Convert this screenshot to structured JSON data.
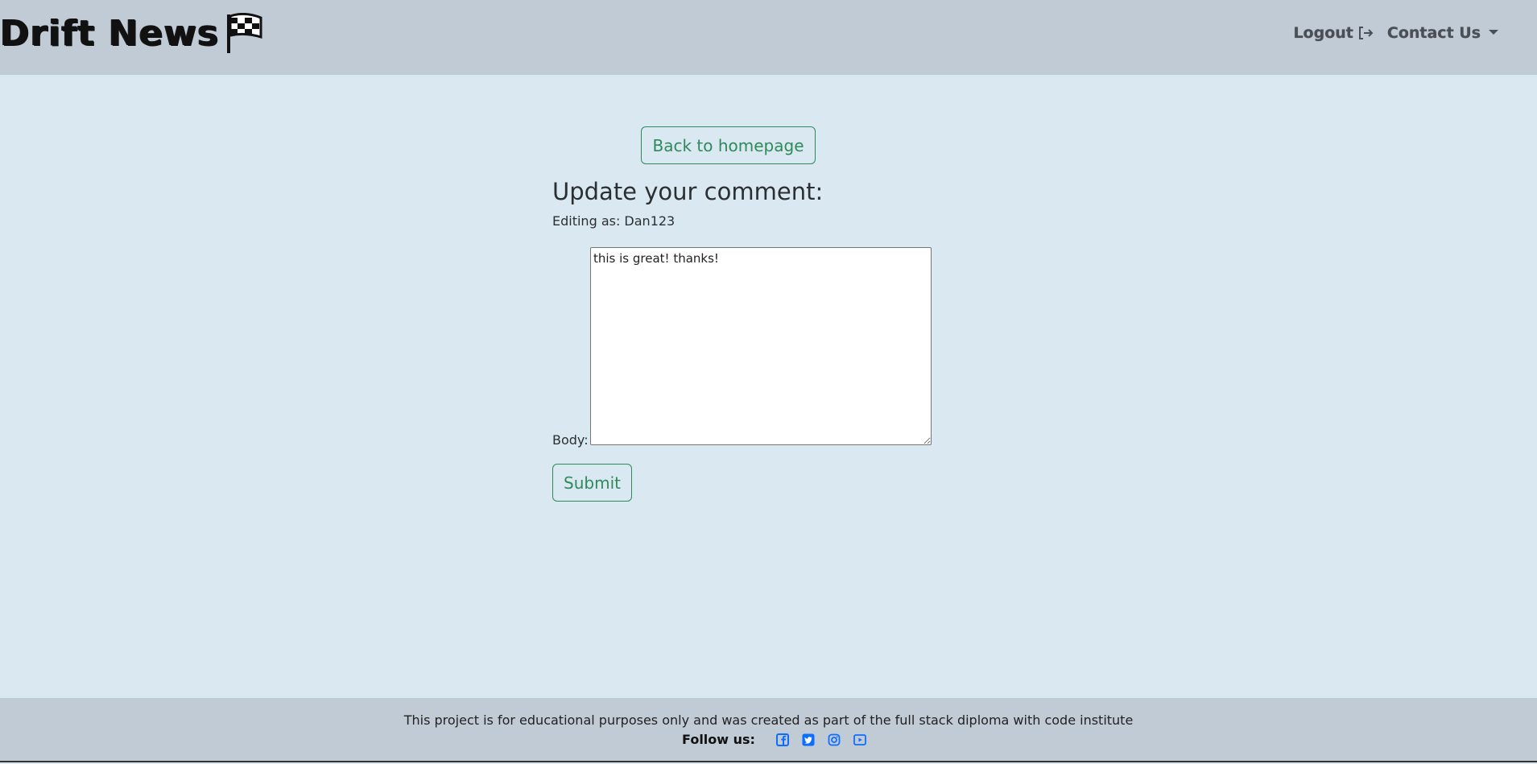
{
  "navbar": {
    "brand": "Drift News",
    "logout_label": "Logout",
    "contact_label": "Contact Us"
  },
  "main": {
    "back_label": "Back to homepage",
    "heading": "Update your comment:",
    "editing_as": "Editing as: Dan123",
    "body_label": "Body:",
    "body_value": "this is great! thanks!",
    "submit_label": "Submit"
  },
  "footer": {
    "text": "This project is for educational purposes only and was created as part of the full stack diploma with code institute",
    "follow_label": "Follow us:",
    "social_icons": [
      "facebook-icon",
      "twitter-icon",
      "instagram-icon",
      "youtube-icon"
    ],
    "social_color": "#0d6efd"
  },
  "colors": {
    "navbar_bg": "#c0cbd6",
    "page_bg": "#dae8f1",
    "accent_green": "#2e8a5b"
  }
}
